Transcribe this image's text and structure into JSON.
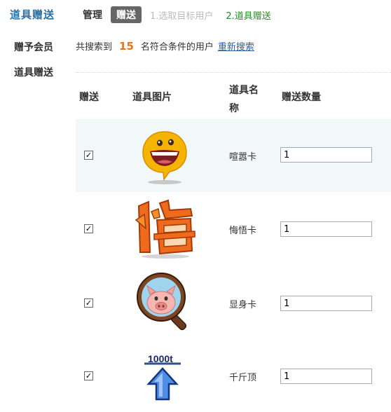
{
  "sidebar": {
    "title": "道具赠送",
    "items": [
      {
        "label": "赠予会员"
      },
      {
        "label": "道具赠送"
      }
    ]
  },
  "tabs": {
    "manage": "管理",
    "gift": "赠送",
    "step1": "1.选取目标用户",
    "step2": "2.道具赠送"
  },
  "summary": {
    "prefix": "共搜索到",
    "count": "15",
    "suffix": "名符合条件的用户",
    "research_link": "重新搜索"
  },
  "table": {
    "headers": {
      "gift": "赠送",
      "image": "道具图片",
      "name_line1": "道具名",
      "name_line2": "称",
      "quantity": "赠送数量"
    },
    "rows": [
      {
        "name": "喧嚣卡",
        "quantity": "1",
        "checked": true,
        "icon": "laughing-face-icon"
      },
      {
        "name": "悔悟卡",
        "quantity": "1",
        "checked": true,
        "icon": "regret-character-icon"
      },
      {
        "name": "显身卡",
        "quantity": "1",
        "checked": true,
        "icon": "magnifier-pig-icon"
      },
      {
        "name": "千斤顶",
        "quantity": "1",
        "checked": true,
        "icon": "1000t-jack-icon"
      }
    ]
  },
  "colors": {
    "title": "#2b6fa3",
    "count": "#e8731a",
    "step_active": "#1c8f1c",
    "row_alt_bg": "#f2f7fa"
  }
}
